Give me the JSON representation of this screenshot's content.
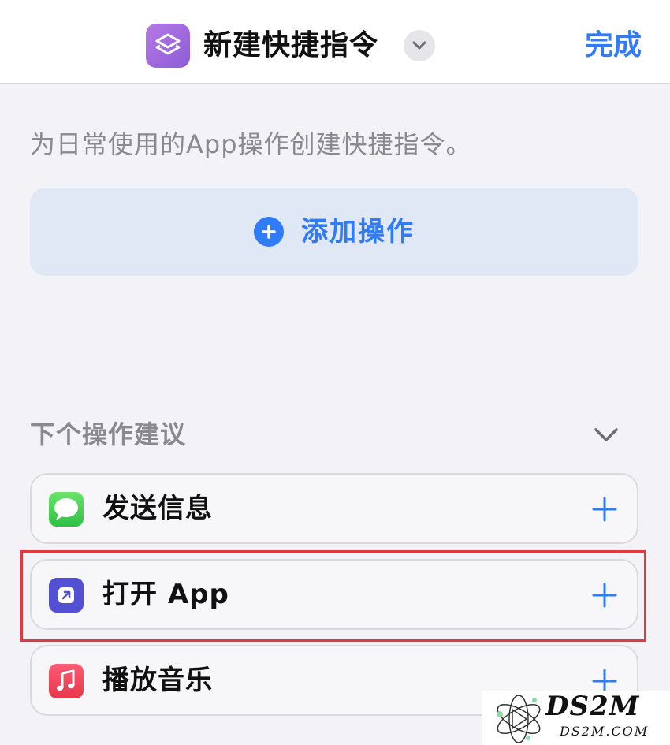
{
  "header": {
    "app_icon": "shortcuts-icon",
    "title": "新建快捷指令",
    "title_menu_icon": "chevron-down-icon",
    "done_label": "完成"
  },
  "description": "为日常使用的App操作创建快捷指令。",
  "add_action": {
    "icon": "plus-circle-icon",
    "label": "添加操作"
  },
  "suggestions": {
    "title": "下个操作建议",
    "toggle_icon": "chevron-down-icon",
    "items": [
      {
        "label": "发送信息",
        "icon": "messages-icon",
        "add_icon": "plus-icon"
      },
      {
        "label": "打开 App",
        "icon": "open-app-icon",
        "add_icon": "plus-icon"
      },
      {
        "label": "播放音乐",
        "icon": "music-icon",
        "add_icon": "plus-icon"
      }
    ]
  },
  "highlighted_item": "打开 App",
  "watermark": {
    "main": "DS2M",
    "sub": "DS2M.COM"
  },
  "colors": {
    "accent": "#2f7cf6",
    "highlight_border": "#e0393e",
    "background": "#f2f2f7"
  }
}
